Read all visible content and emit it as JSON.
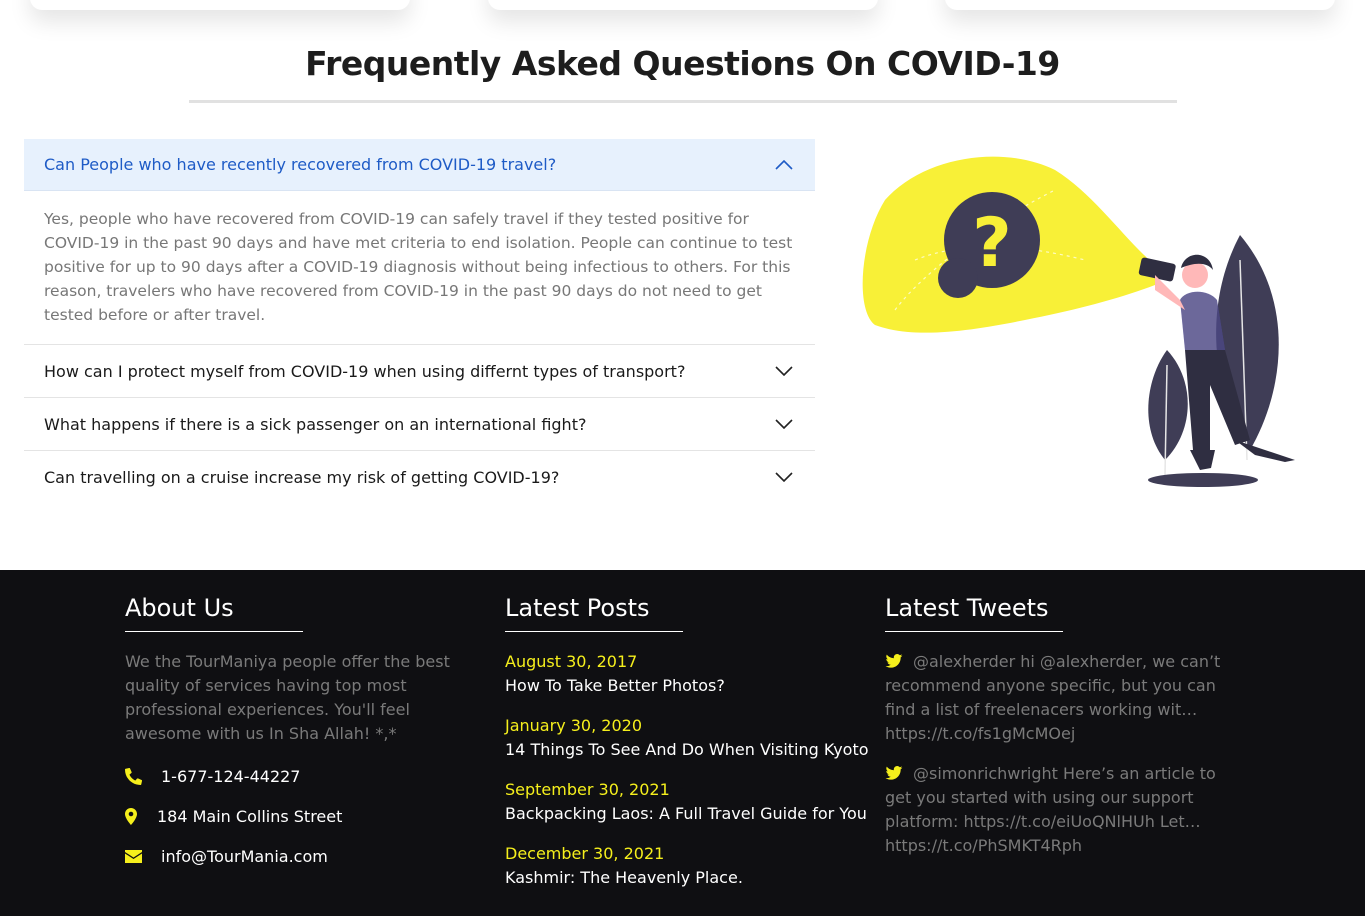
{
  "faq": {
    "title": "Frequently Asked Questions On COVID-19",
    "items": [
      {
        "question": "Can People who have recently recovered from COVID-19 travel?",
        "answer": "Yes, people who have recovered from COVID-19 can safely travel if they tested positive for COVID-19 in the past 90 days and have met criteria to end isolation. People can continue to test positive for up to 90 days after a COVID-19 diagnosis without being infectious to others. For this reason, travelers who have recovered from COVID-19 in the past 90 days do not need to get tested before or after travel.",
        "expanded": true
      },
      {
        "question": "How can I protect myself from COVID-19 when using differnt types of transport?",
        "expanded": false
      },
      {
        "question": "What happens if there is a sick passenger on an international fight?",
        "expanded": false
      },
      {
        "question": "Can travelling on a cruise increase my risk of getting COVID-19?",
        "expanded": false
      }
    ]
  },
  "footer": {
    "about": {
      "heading": "About Us",
      "text": "We the TourManiya people offer the best quality of services having top most professional experiences. You'll feel awesome with us In Sha Allah! *,*",
      "phone": "1-677-124-44227",
      "address": "184 Main Collins Street",
      "email": "info@TourMania.com"
    },
    "posts": {
      "heading": "Latest Posts",
      "items": [
        {
          "date": "August 30, 2017",
          "title": "How To Take Better Photos?"
        },
        {
          "date": "January 30, 2020",
          "title": "14 Things To See And Do When Visiting Kyoto"
        },
        {
          "date": "September 30, 2021",
          "title": "Backpacking Laos: A Full Travel Guide for You"
        },
        {
          "date": "December 30, 2021",
          "title": "Kashmir: The Heavenly Place."
        }
      ]
    },
    "tweets": {
      "heading": "Latest Tweets",
      "items": [
        {
          "text": "@alexherder hi @alexherder, we can’t recommend anyone specific, but you can find a list of freelenacers working wit… https://t.co/fs1gMcMOej"
        },
        {
          "text": "@simonrichwright Here’s an article to get you started with using our support platform: https://t.co/eiUoQNlHUh Let… https://t.co/PhSMKT4Rph"
        }
      ]
    }
  },
  "colors": {
    "accent_yellow": "#f5ef1c",
    "faq_active_bg": "#e7f1fd",
    "faq_active_text": "#1e5bc6",
    "footer_bg": "#0f0f12",
    "illustration_dark": "#3f3d56"
  },
  "icons": {
    "chevron_up": "chevron-up-icon",
    "chevron_down": "chevron-down-icon",
    "phone": "phone-icon",
    "location": "map-marker-icon",
    "email": "envelope-icon",
    "twitter": "twitter-icon"
  }
}
